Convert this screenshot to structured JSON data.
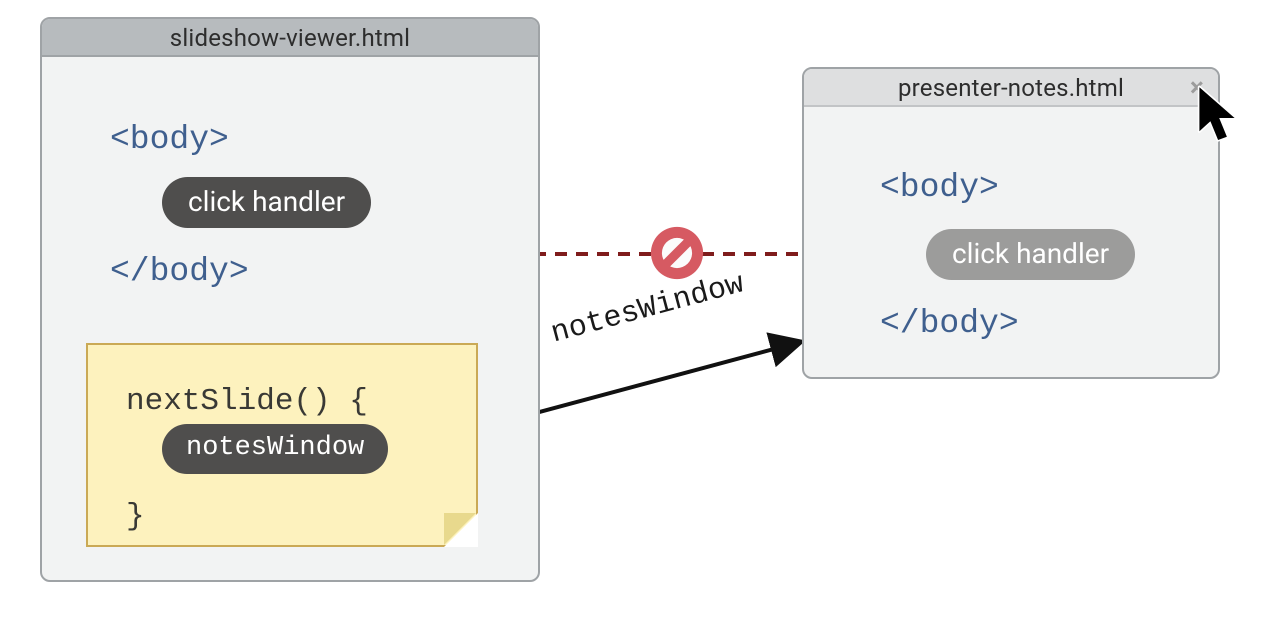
{
  "leftWindow": {
    "title": "slideshow-viewer.html",
    "bodyOpen": "<body>",
    "bodyClose": "</body>",
    "clickHandlerLabel": "click handler"
  },
  "rightWindow": {
    "title": "presenter-notes.html",
    "bodyOpen": "<body>",
    "bodyClose": "</body>",
    "clickHandlerLabel": "click handler",
    "closeGlyph": "×"
  },
  "note": {
    "funcOpen": "nextSlide() {",
    "varPill": "notesWindow",
    "funcClose": "}"
  },
  "labels": {
    "arrowToRight": "notesWindow"
  }
}
